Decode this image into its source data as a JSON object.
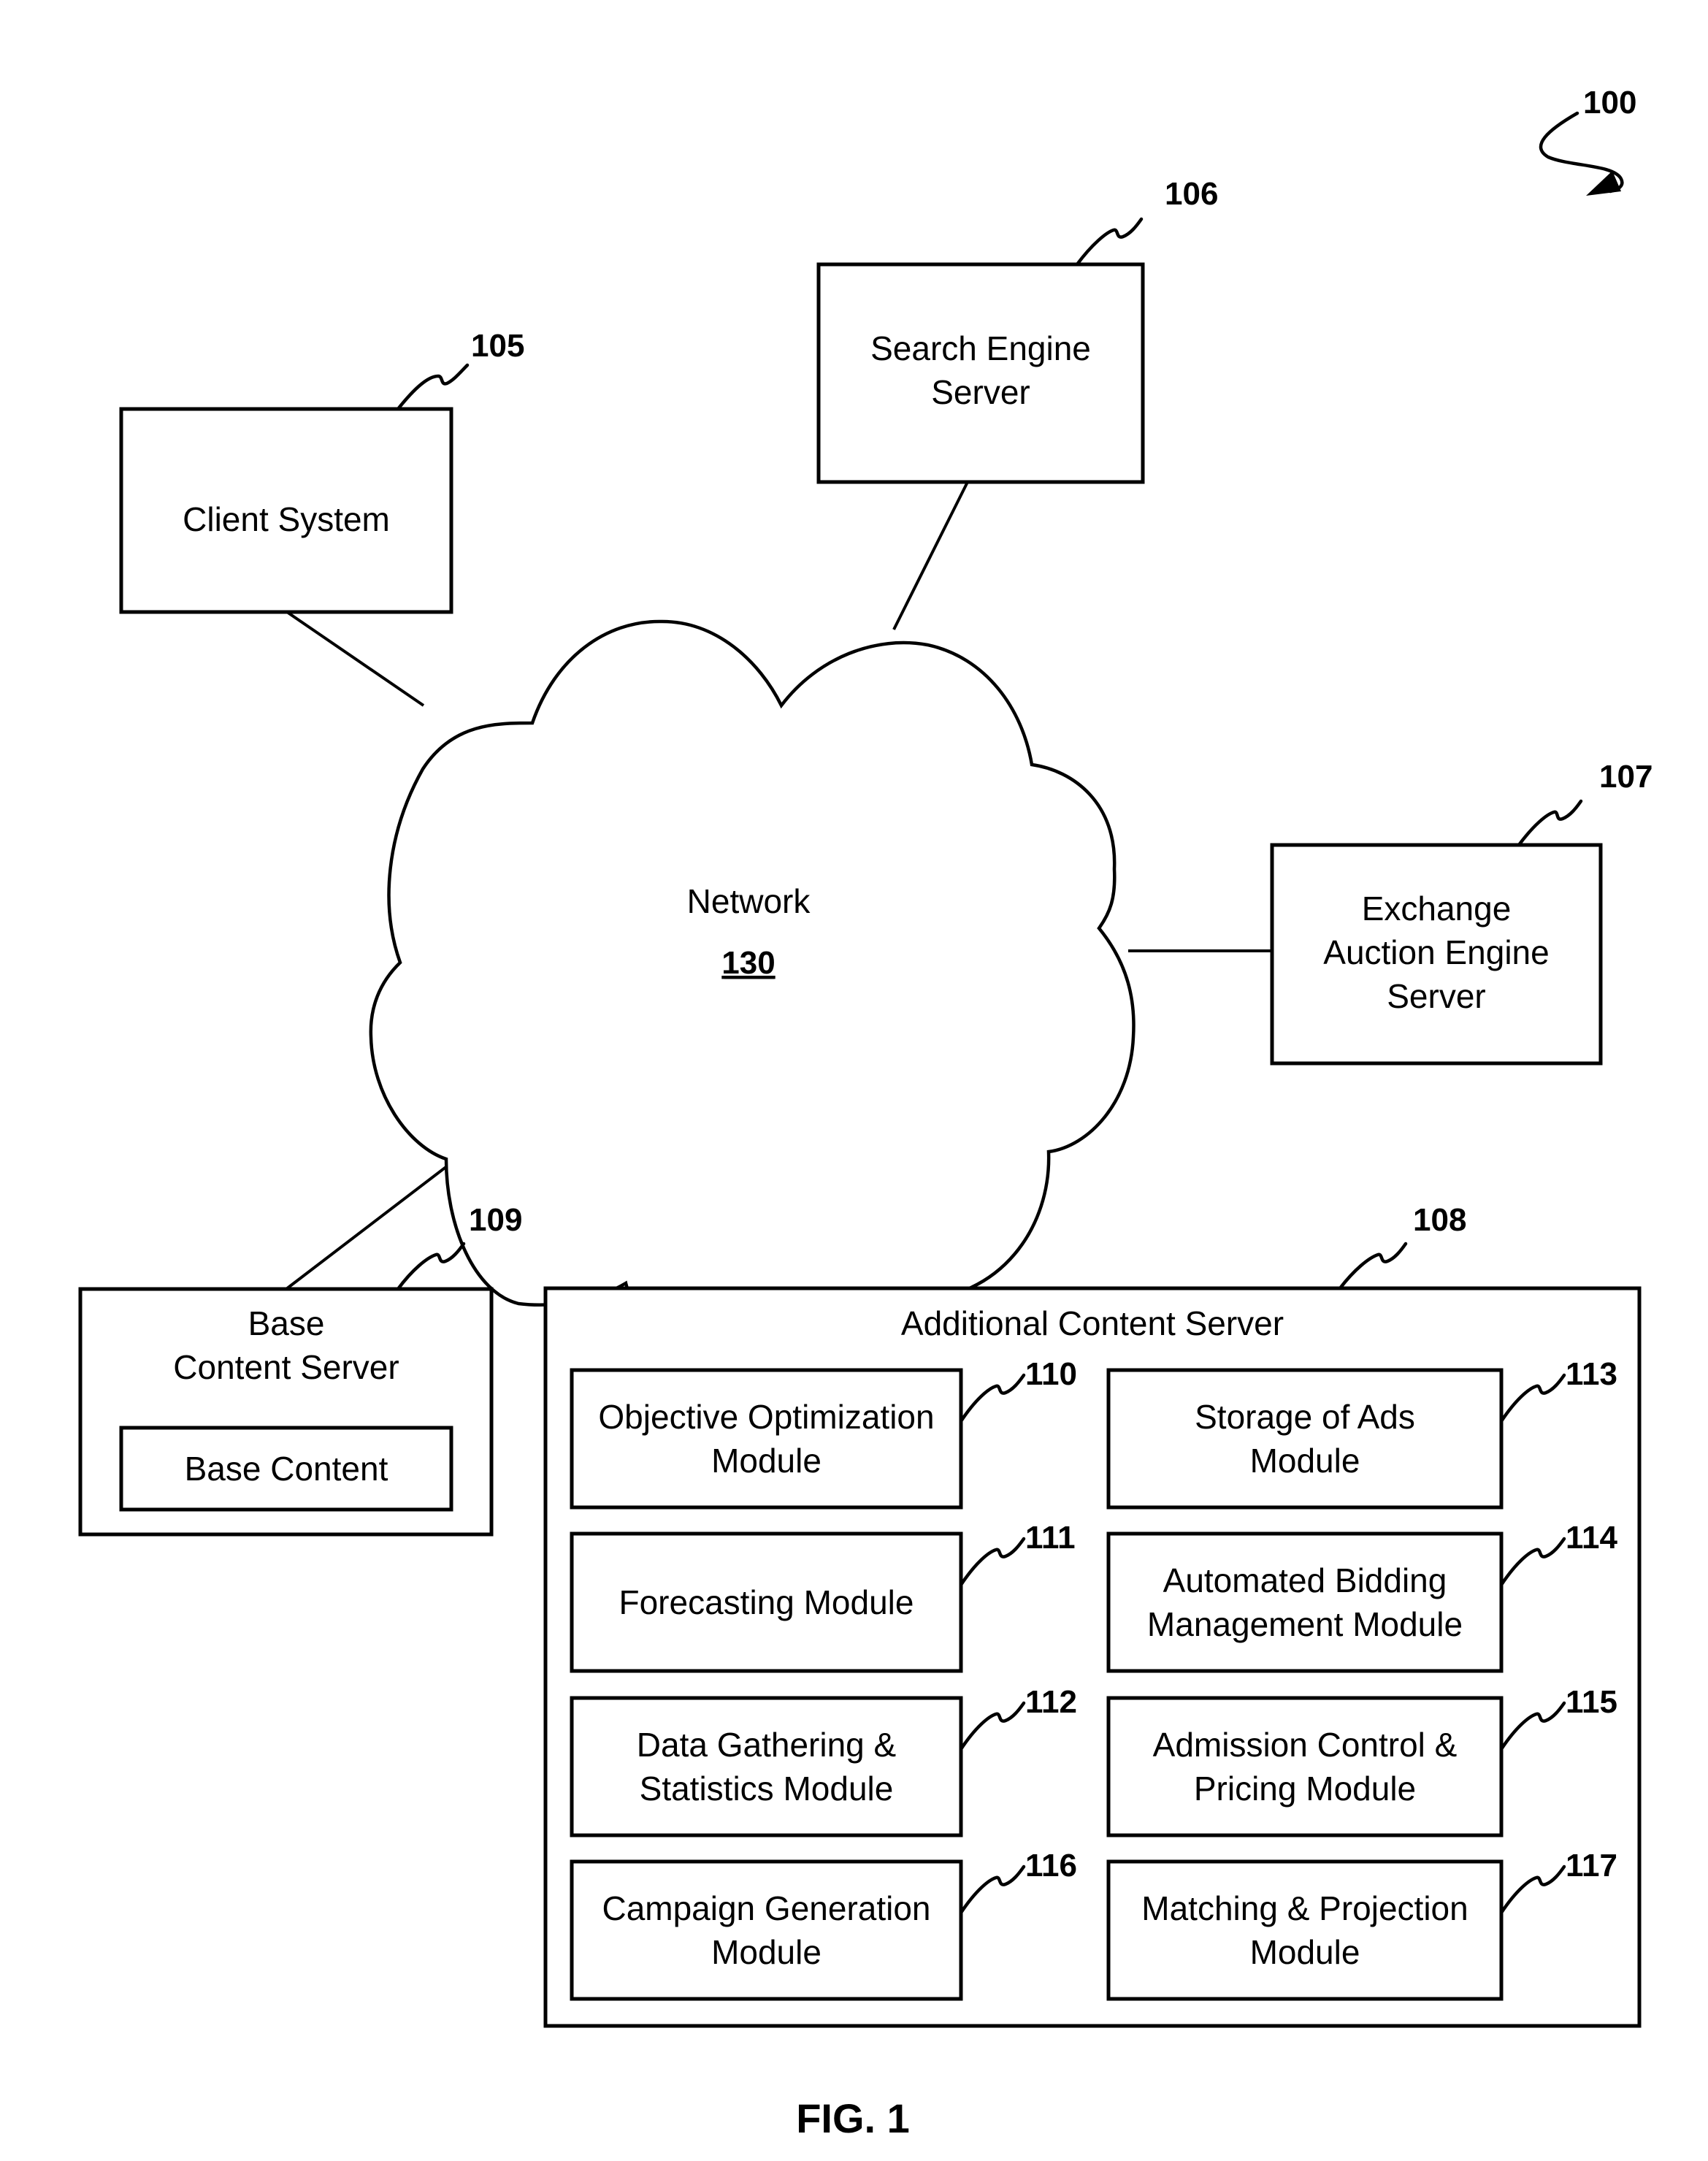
{
  "figure": {
    "ref": "100",
    "caption": "FIG. 1"
  },
  "network": {
    "label": "Network",
    "ref": "130"
  },
  "client_system": {
    "label_lines": [
      "Client System"
    ],
    "ref": "105"
  },
  "search_engine_server": {
    "label_lines": [
      "Search Engine",
      "Server"
    ],
    "ref": "106"
  },
  "exchange_auction_engine_server": {
    "label_lines": [
      "Exchange",
      "Auction Engine",
      "Server"
    ],
    "ref": "107"
  },
  "base_content_server": {
    "label_lines": [
      "Base",
      "Content Server"
    ],
    "ref": "109",
    "inner": {
      "label": "Base Content"
    }
  },
  "additional_content_server": {
    "label": "Additional Content Server",
    "ref": "108",
    "modules": [
      {
        "lines": [
          "Objective Optimization",
          "Module"
        ],
        "ref": "110"
      },
      {
        "lines": [
          "Storage of Ads",
          "Module"
        ],
        "ref": "113"
      },
      {
        "lines": [
          "Forecasting Module"
        ],
        "ref": "111"
      },
      {
        "lines": [
          "Automated Bidding",
          "Management Module"
        ],
        "ref": "114"
      },
      {
        "lines": [
          "Data Gathering &",
          "Statistics Module"
        ],
        "ref": "112"
      },
      {
        "lines": [
          "Admission Control &",
          "Pricing Module"
        ],
        "ref": "115"
      },
      {
        "lines": [
          "Campaign Generation",
          "Module"
        ],
        "ref": "116"
      },
      {
        "lines": [
          "Matching & Projection",
          "Module"
        ],
        "ref": "117"
      }
    ]
  }
}
